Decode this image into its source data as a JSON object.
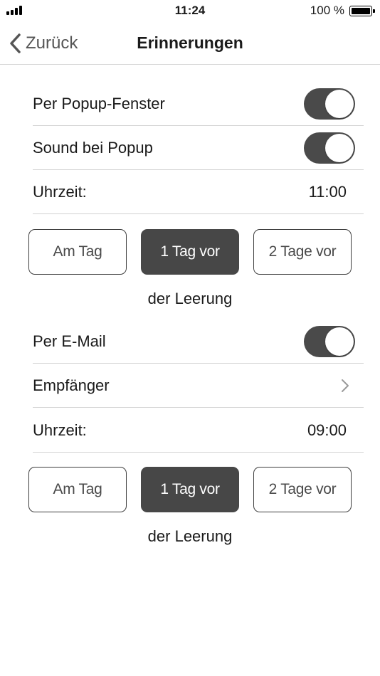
{
  "status_bar": {
    "time": "11:24",
    "battery_percent": "100 %",
    "battery_level": 1.0
  },
  "nav": {
    "back_label": "Zurück",
    "title": "Erinnerungen"
  },
  "popup_section": {
    "popup_row": {
      "label": "Per Popup-Fenster",
      "enabled": true
    },
    "sound_row": {
      "label": "Sound bei Popup",
      "enabled": true
    },
    "time_row": {
      "label": "Uhrzeit:",
      "value": "11:00"
    },
    "options": [
      {
        "label": "Am Tag",
        "selected": false
      },
      {
        "label": "1 Tag vor",
        "selected": true
      },
      {
        "label": "2 Tage vor",
        "selected": false
      }
    ],
    "caption": "der Leerung"
  },
  "email_section": {
    "email_row": {
      "label": "Per E-Mail",
      "enabled": true
    },
    "recipient_row": {
      "label": "Empfänger"
    },
    "time_row": {
      "label": "Uhrzeit:",
      "value": "09:00"
    },
    "options": [
      {
        "label": "Am Tag",
        "selected": false
      },
      {
        "label": "1 Tag vor",
        "selected": true
      },
      {
        "label": "2 Tage vor",
        "selected": false
      }
    ],
    "caption": "der Leerung"
  },
  "colors": {
    "toggle_on": "#4a4a4a",
    "segment_active": "#474747",
    "separator": "#d3d3d3"
  }
}
